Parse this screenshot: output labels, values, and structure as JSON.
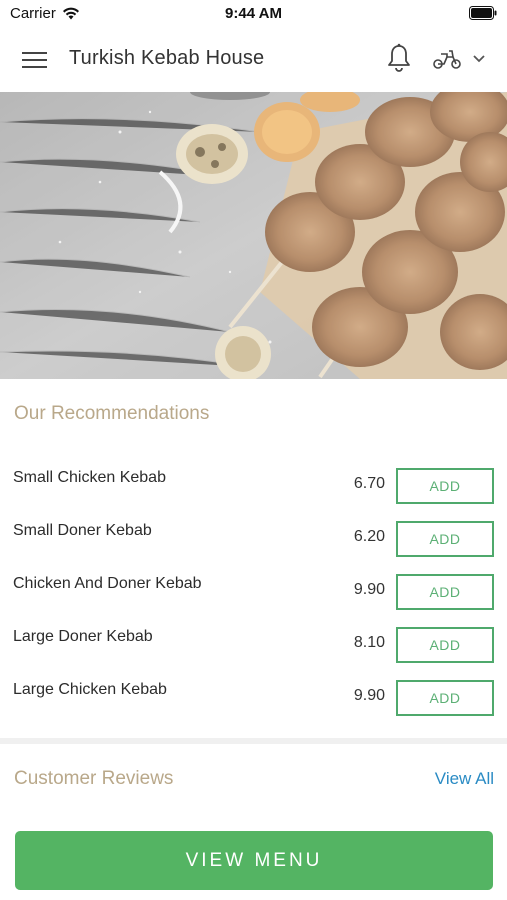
{
  "status_bar": {
    "carrier": "Carrier",
    "time": "9:44 AM"
  },
  "header": {
    "title": "Turkish Kebab House",
    "icons": [
      "menu-icon",
      "bell-icon",
      "scooter-icon",
      "chevron-down-icon"
    ]
  },
  "hero": {
    "image": "grilled chicken kebab skewers on wooden board"
  },
  "recommendations": {
    "title": "Our Recommendations",
    "add_label": "ADD",
    "items": [
      {
        "name": "Small Chicken Kebab",
        "price": "6.70"
      },
      {
        "name": "Small Doner Kebab",
        "price": "6.20"
      },
      {
        "name": "Chicken And Doner Kebab",
        "price": "9.90"
      },
      {
        "name": "Large Doner Kebab",
        "price": "8.10"
      },
      {
        "name": "Large Chicken Kebab",
        "price": "9.90"
      }
    ]
  },
  "reviews": {
    "title": "Customer Reviews",
    "view_all": "View All"
  },
  "cta": {
    "label": "VIEW MENU"
  },
  "colors": {
    "accent_green": "#54b463",
    "section_title": "#b9a88a",
    "link_blue": "#2a8bc4"
  }
}
